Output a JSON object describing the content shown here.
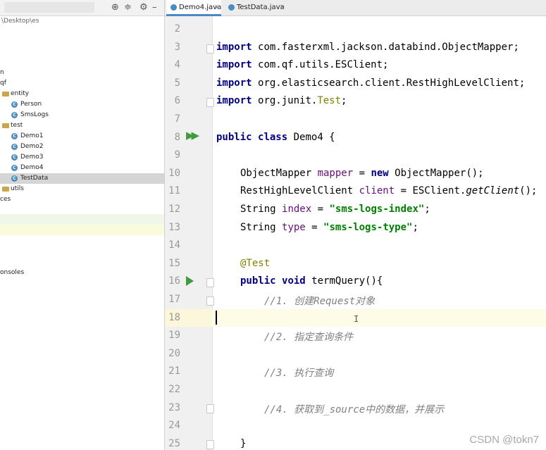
{
  "project_panel": {
    "toolbar_icons": [
      "target-icon",
      "collapse-icon",
      "gear-icon",
      "hide-icon"
    ],
    "path_fragment": "\\Desktop\\es",
    "tree": [
      {
        "label": "n",
        "kind": "text"
      },
      {
        "label": "qf",
        "kind": "text"
      },
      {
        "label": "entity",
        "kind": "folder"
      },
      {
        "label": "Person",
        "kind": "class"
      },
      {
        "label": "SmsLogs",
        "kind": "class"
      },
      {
        "label": "test",
        "kind": "folder"
      },
      {
        "label": "Demo1",
        "kind": "class"
      },
      {
        "label": "Demo2",
        "kind": "class"
      },
      {
        "label": "Demo3",
        "kind": "class"
      },
      {
        "label": "Demo4",
        "kind": "class"
      },
      {
        "label": "TestData",
        "kind": "class",
        "selected": true
      },
      {
        "label": "utils",
        "kind": "folder"
      },
      {
        "label": "ces",
        "kind": "text"
      },
      {
        "label": "onsoles",
        "kind": "text"
      }
    ]
  },
  "tabs": [
    {
      "label": "Demo4.java",
      "active": true
    },
    {
      "label": "TestData.java",
      "active": false
    }
  ],
  "editor": {
    "current_line": 18,
    "lines": [
      {
        "n": "2"
      },
      {
        "n": "3"
      },
      {
        "n": "4"
      },
      {
        "n": "5"
      },
      {
        "n": "6"
      },
      {
        "n": "7"
      },
      {
        "n": "8"
      },
      {
        "n": "9"
      },
      {
        "n": "10"
      },
      {
        "n": "11"
      },
      {
        "n": "12"
      },
      {
        "n": "13"
      },
      {
        "n": "14"
      },
      {
        "n": "15"
      },
      {
        "n": "16"
      },
      {
        "n": "17"
      },
      {
        "n": "18"
      },
      {
        "n": "19"
      },
      {
        "n": "20"
      },
      {
        "n": "21"
      },
      {
        "n": "22"
      },
      {
        "n": "23"
      },
      {
        "n": "24"
      },
      {
        "n": "25"
      }
    ],
    "tokens": {
      "import": "import",
      "imp1": "com.fasterxml.jackson.databind.ObjectMapper;",
      "imp2": "com.qf.utils.ESClient;",
      "imp3": "org.elasticsearch.client.RestHighLevelClient;",
      "imp4a": "org.junit.",
      "imp4b": "Test",
      "imp4c": ";",
      "public": "public",
      "class": "class",
      "classname": "Demo4 {",
      "l10a": "ObjectMapper ",
      "l10b": "mapper",
      "l10c": " = ",
      "new": "new",
      "l10d": " ObjectMapper();",
      "l11a": "RestHighLevelClient ",
      "l11b": "client",
      "l11c": " = ESClient.",
      "l11d": "getClient",
      "l11e": "();",
      "l12a": "String ",
      "l12b": "index",
      "l12c": " = ",
      "l12d": "\"sms-logs-index\"",
      "l12e": ";",
      "l13a": "String ",
      "l13b": "type",
      "l13c": " = ",
      "l13d": "\"sms-logs-type\"",
      "l13e": ";",
      "annot": "@Test",
      "void": "void",
      "method": "termQuery(){",
      "c1": "//1. 创建Request对象",
      "c2": "//2. 指定查询条件",
      "c3": "//3. 执行查询",
      "c4": "//4. 获取到_source中的数据，并展示",
      "close": "}"
    }
  },
  "watermark": "CSDN @tokn7",
  "colors": {
    "keyword": "#000080",
    "string": "#008000",
    "field": "#660e7a",
    "comment": "#808080",
    "annotation": "#808000",
    "run": "#3e9b3e"
  }
}
